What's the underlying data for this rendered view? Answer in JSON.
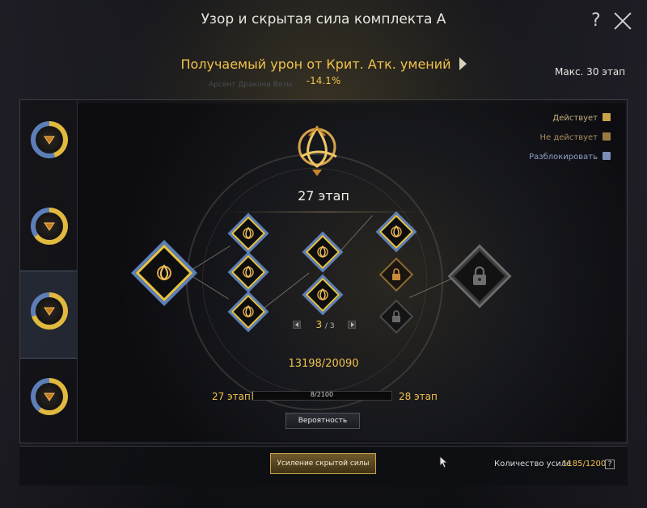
{
  "window": {
    "title": "Узор и скрытая сила комплекта А",
    "help_glyph": "?"
  },
  "effect": {
    "name": "Получаемый урон от Крит. Атк. умений",
    "value": "-14.1%",
    "ghost_text": "Арсент Дракона Везы"
  },
  "max_stage": "Макс. 30 этап",
  "legend": [
    {
      "label": "Действует",
      "color": "#c9a24a"
    },
    {
      "label": "Не действует",
      "color": "#9a7a40"
    },
    {
      "label": "Разблокировать",
      "color": "#7d8fb7"
    }
  ],
  "sidebar": {
    "items": [
      {
        "name": "set-slot-1",
        "progress": 0.45
      },
      {
        "name": "set-slot-2",
        "progress": 0.65
      },
      {
        "name": "set-slot-3",
        "progress": 0.7
      },
      {
        "name": "set-slot-4",
        "progress": 0.6
      }
    ]
  },
  "stage": {
    "current": "27 этап"
  },
  "pager": {
    "current": "3",
    "total": "/ 3"
  },
  "points": "13198/20090",
  "progress": {
    "from": "27 этап",
    "to": "28 этап",
    "text": "8/2100",
    "value": 0.004
  },
  "buttons": {
    "probability": "Вероятность",
    "upgrade": "Усиление скрытой силы"
  },
  "count": {
    "label": "Количество усиле",
    "value": "1185/1200",
    "help": "?"
  },
  "colors": {
    "accent": "#f2c34a",
    "active_border": "#e6c341",
    "unlock_blue": "#5d7fb8"
  }
}
